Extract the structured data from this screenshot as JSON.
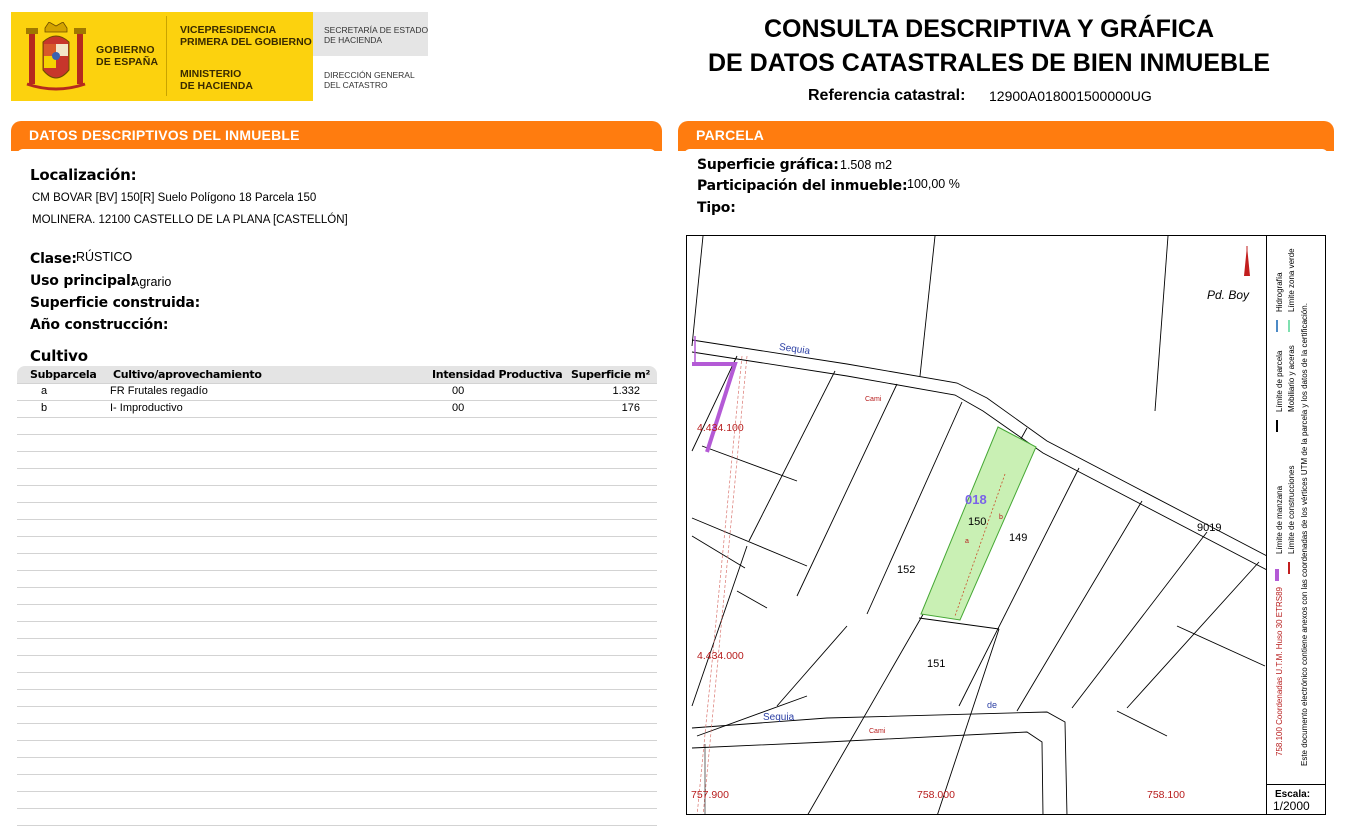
{
  "header": {
    "gobierno": [
      "GOBIERNO",
      "DE ESPAÑA"
    ],
    "vicepresidencia": [
      "VICEPRESIDENCIA",
      "PRIMERA DEL GOBIERNO"
    ],
    "ministerio": [
      "MINISTERIO",
      "DE HACIENDA"
    ],
    "secretaria": [
      "SECRETARÍA DE ESTADO",
      "DE HACIENDA"
    ],
    "direccion": [
      "DIRECCIÓN GENERAL",
      "DEL CATASTRO"
    ],
    "title_line1": "CONSULTA DESCRIPTIVA Y GRÁFICA",
    "title_line2": "DE DATOS CATASTRALES DE BIEN INMUEBLE",
    "ref_label": "Referencia catastral:",
    "ref_value": "12900A018001500000UG"
  },
  "left": {
    "bar_title_prefix": "DATOS DESCRIPTIVOS DEL ",
    "bar_title_bold": "INMUEBLE",
    "localizacion_label": "Localización:",
    "localizacion_line1": "CM BOVAR [BV] 150[R] Suelo Polígono 18 Parcela 150",
    "localizacion_line2": "MOLINERA. 12100 CASTELLO DE LA PLANA [CASTELLÓN]",
    "clase_label": "Clase:",
    "clase_value": "RÚSTICO",
    "uso_label": "Uso principal:",
    "uso_value": "Agrario",
    "sup_construida_label": "Superficie construida:",
    "anio_label": "Año construcción:",
    "cultivo_label": "Cultivo",
    "table": {
      "headers": [
        "Subparcela",
        "Cultivo/aprovechamiento",
        "Intensidad Productiva",
        "Superficie m²"
      ],
      "rows": [
        [
          "a",
          "FR Frutales regadío",
          "00",
          "1.332"
        ],
        [
          "b",
          "I- Improductivo",
          "00",
          "176"
        ]
      ]
    }
  },
  "right": {
    "bar_title": "PARCELA",
    "sup_grafica_label": "Superficie gráfica:",
    "sup_grafica_value": "1.508 m2",
    "participacion_label": "Participación del inmueble:",
    "participacion_value": "100,00 %",
    "tipo_label": "Tipo:",
    "map": {
      "labels": {
        "pd_boy": "Pd. Boy",
        "sequia_top": "Sequia",
        "sequia_bottom": "Sequia",
        "cami_top": "Cami",
        "cami_bottom": "Cami",
        "poly": "018",
        "p150": "150",
        "p149": "149",
        "p152": "152",
        "p151": "151",
        "p9019": "9019",
        "sub_a": "a",
        "sub_b": "b",
        "de": "de",
        "y_434100": "4.434.100",
        "y_434000": "4.434.000",
        "x_757900": "757.900",
        "x_758000": "758.000",
        "x_758100": "758.100"
      },
      "colors": {
        "parcel_fill": "#c9f0b4",
        "parcel_stroke": "#46a835",
        "coord_red": "#b71c1c",
        "boundary_purple": "#b45ad6"
      }
    },
    "legend": {
      "col1": "758.100 Coordenadas U.T.M. Huso 30 ETRS89",
      "col2a": "Límite de manzana",
      "col2b": "Límite de parcela",
      "col2c": "Hidrografía",
      "col3a": "Límite de construcciones",
      "col3b": "Mobiliario y aceras",
      "col3c": "Límite zona verde",
      "col4": "Este documento electrónico contiene anexos con las coordenadas de los vértices UTM de la parcela y los datos de la certificación."
    },
    "escala_label": "Escala:",
    "escala_value": "1/2000"
  }
}
